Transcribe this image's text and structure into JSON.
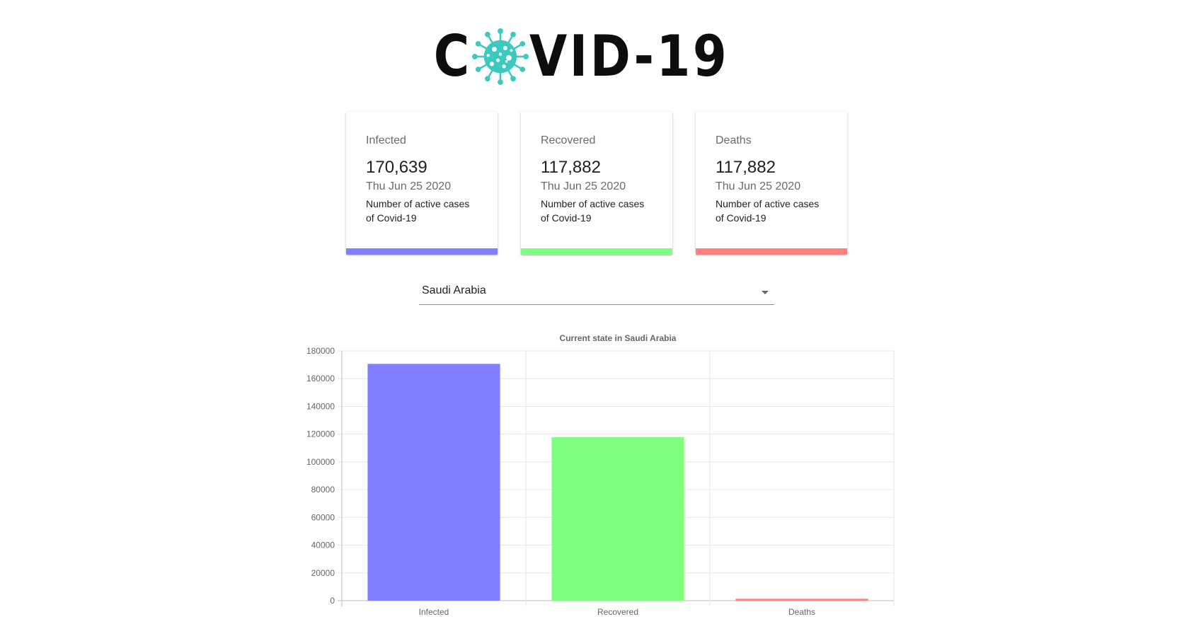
{
  "logo": {
    "text_before": "C",
    "text_after": "VID-19",
    "virus_icon": "coronavirus-icon",
    "virus_color": "#3cc9c0"
  },
  "cards": [
    {
      "title": "Infected",
      "value": "170,639",
      "date": "Thu Jun 25 2020",
      "description": "Number of active cases of Covid-19",
      "color": "#7f7fff"
    },
    {
      "title": "Recovered",
      "value": "117,882",
      "date": "Thu Jun 25 2020",
      "description": "Number of active cases of Covid-19",
      "color": "#7fff7f"
    },
    {
      "title": "Deaths",
      "value": "117,882",
      "date": "Thu Jun 25 2020",
      "description": "Number of active cases of Covid-19",
      "color": "#ff7f7f"
    }
  ],
  "country_select": {
    "selected": "Saudi Arabia",
    "icon": "dropdown-arrow-icon"
  },
  "chart_data": {
    "type": "bar",
    "title": "Current state in Saudi Arabia",
    "categories": [
      "Infected",
      "Recovered",
      "Deaths"
    ],
    "values": [
      170639,
      117882,
      1346
    ],
    "colors": [
      "#7f7fff",
      "#7fff7f",
      "#ff7f7f"
    ],
    "ylim": [
      0,
      180000
    ],
    "yticks": [
      0,
      20000,
      40000,
      60000,
      80000,
      100000,
      120000,
      140000,
      160000,
      180000
    ],
    "grid": true,
    "legend": "none",
    "xlabel": "",
    "ylabel": ""
  }
}
